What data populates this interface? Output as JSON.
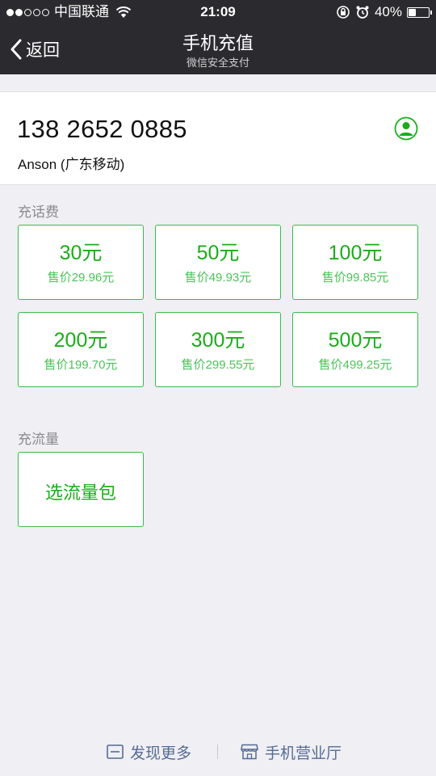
{
  "status_bar": {
    "carrier": "中国联通",
    "time": "21:09",
    "battery_percent": "40%",
    "battery_level": 0.4,
    "signal_bars_filled": 2,
    "signal_bars_total": 5
  },
  "nav": {
    "back_label": "返回",
    "title": "手机充值",
    "subtitle": "微信安全支付"
  },
  "phone": {
    "number": "138 2652 0885",
    "owner": "Anson (广东移动)"
  },
  "recharge_section": {
    "label": "充话费",
    "options": [
      {
        "amount": "30元",
        "price": "售价29.96元"
      },
      {
        "amount": "50元",
        "price": "售价49.93元"
      },
      {
        "amount": "100元",
        "price": "售价99.85元"
      },
      {
        "amount": "200元",
        "price": "售价199.70元"
      },
      {
        "amount": "300元",
        "price": "售价299.55元"
      },
      {
        "amount": "500元",
        "price": "售价499.25元"
      }
    ]
  },
  "data_section": {
    "label": "充流量",
    "option_label": "选流量包"
  },
  "footer": {
    "discover_label": "发现更多",
    "hall_label": "手机营业厅"
  },
  "colors": {
    "accent_green": "#1aad19",
    "link_blue": "#576b95",
    "header_bg": "#2b2b2f",
    "page_bg": "#efeff4"
  },
  "icons": {
    "back": "chevron-left-icon",
    "contact": "person-circle-icon",
    "wifi": "wifi-icon",
    "rotation_lock": "rotation-lock-icon",
    "alarm": "alarm-icon",
    "battery": "battery-icon",
    "discover": "window-icon",
    "hall": "store-icon"
  }
}
